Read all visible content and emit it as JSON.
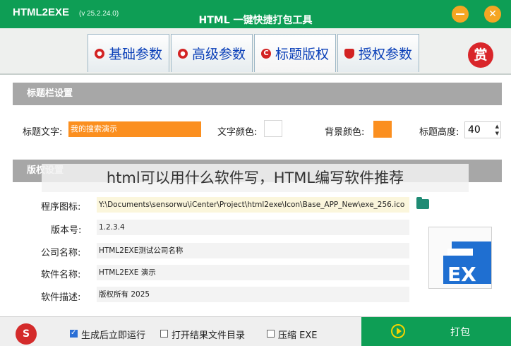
{
  "titlebar": {
    "app_name": "HTML2EXE",
    "version": "(v 25.2.24.0)",
    "title": "HTML 一键快捷打包工具"
  },
  "tabs": [
    {
      "label": "基础参数",
      "icon": "gear-icon"
    },
    {
      "label": "高级参数",
      "icon": "gear-icon"
    },
    {
      "label": "标题版权",
      "icon": "copyright-icon",
      "active": true
    },
    {
      "label": "授权参数",
      "icon": "shield-icon"
    }
  ],
  "reward_label": "赏",
  "titlebar_settings": {
    "header": "标题栏设置",
    "title_text_label": "标题文字:",
    "title_text_value": "我的搜索演示",
    "text_color_label": "文字颜色:",
    "text_color": "#ffffff",
    "bg_color_label": "背景颜色:",
    "bg_color": "#fb8f1f",
    "height_label": "标题高度:",
    "height_value": "40"
  },
  "copyright_settings": {
    "header": "版权设置",
    "icon_label": "程序图标:",
    "icon_path": "Y:\\Documents\\sensorwu\\iCenter\\Project\\html2exe\\Icon\\Base_APP_New\\exe_256.ico",
    "version_label": "版本号:",
    "version_value": "1.2.3.4",
    "company_label": "公司名称:",
    "company_value": "HTML2EXE测试公司名称",
    "software_label": "软件名称:",
    "software_value": "HTML2EXE 演示",
    "desc_label": "软件描述:",
    "desc_value": "版权所有 2025"
  },
  "icon_preview_text": "EX",
  "overlay_caption": "html可以用什么软件写，HTML编写软件推荐",
  "footer": {
    "run_after_label": "生成后立即运行",
    "run_after_checked": true,
    "open_dir_label": "打开结果文件目录",
    "open_dir_checked": false,
    "compress_label": "压缩 EXE",
    "compress_checked": false,
    "pack_label": "打包"
  }
}
